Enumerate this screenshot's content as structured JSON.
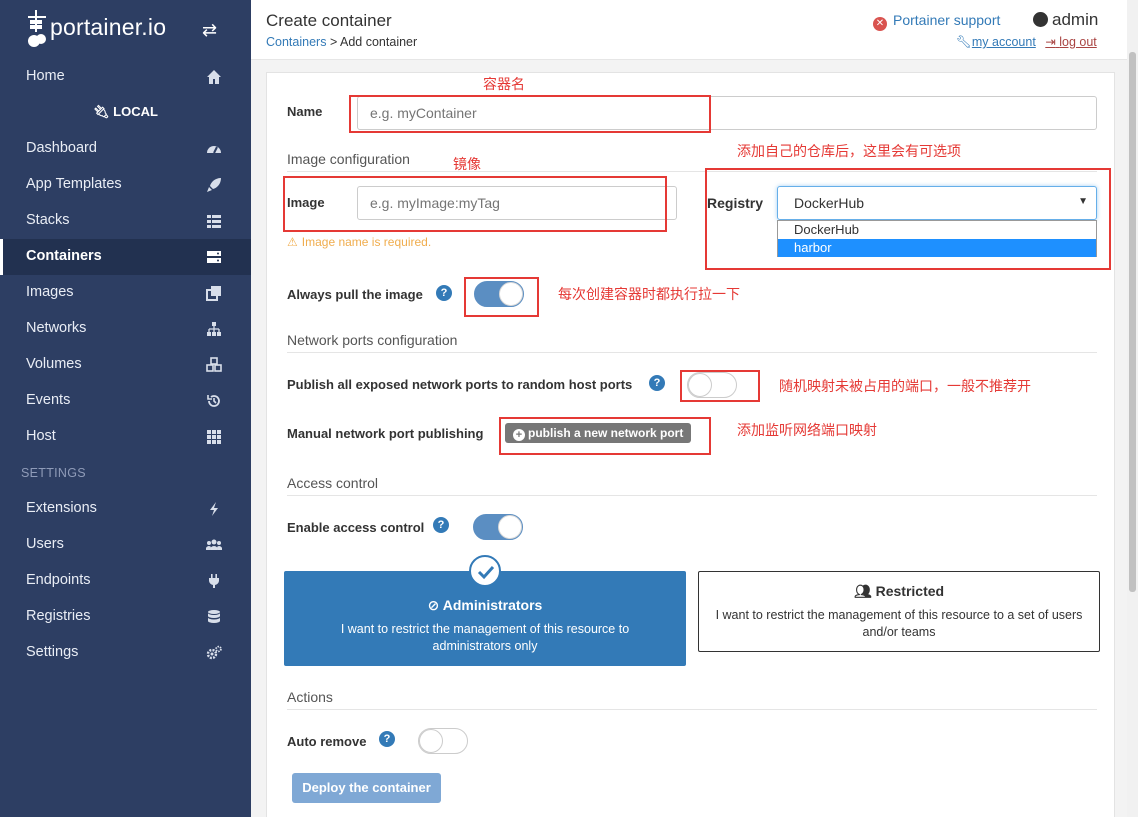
{
  "app": {
    "name": "portainer.io"
  },
  "sidebar": {
    "items": [
      {
        "label": "Home",
        "icon": "home-icon"
      },
      {
        "label": "Dashboard",
        "icon": "tachometer-icon"
      },
      {
        "label": "App Templates",
        "icon": "rocket-icon"
      },
      {
        "label": "Stacks",
        "icon": "th-list-icon"
      },
      {
        "label": "Containers",
        "icon": "server-icon",
        "active": true
      },
      {
        "label": "Images",
        "icon": "clone-icon"
      },
      {
        "label": "Networks",
        "icon": "sitemap-icon"
      },
      {
        "label": "Volumes",
        "icon": "cubes-icon"
      },
      {
        "label": "Events",
        "icon": "history-icon"
      },
      {
        "label": "Host",
        "icon": "th-icon"
      }
    ],
    "endpoint_label": "LOCAL",
    "settings_heading": "SETTINGS",
    "settings_items": [
      {
        "label": "Extensions",
        "icon": "bolt-icon"
      },
      {
        "label": "Users",
        "icon": "users-icon"
      },
      {
        "label": "Endpoints",
        "icon": "plug-icon"
      },
      {
        "label": "Registries",
        "icon": "database-icon"
      },
      {
        "label": "Settings",
        "icon": "cogs-icon"
      }
    ]
  },
  "header": {
    "title": "Create container",
    "breadcrumb_link": "Containers",
    "breadcrumb_current": "> Add container",
    "support_label": "Portainer support",
    "user": "admin",
    "my_account": "my account",
    "log_out": "log out"
  },
  "form": {
    "name_label": "Name",
    "name_placeholder": "e.g. myContainer",
    "image_config_heading": "Image configuration",
    "image_label": "Image",
    "image_placeholder": "e.g. myImage:myTag",
    "image_warning": "Image name is required.",
    "registry_label": "Registry",
    "registry_selected": "DockerHub",
    "registry_options": [
      "DockerHub",
      "harbor"
    ],
    "always_pull_label": "Always pull the image",
    "always_pull": true,
    "network_heading": "Network ports configuration",
    "publish_all_label": "Publish all exposed network ports to random host ports",
    "publish_all": false,
    "manual_publish_label": "Manual network port publishing",
    "publish_button": "publish a new network port",
    "access_heading": "Access control",
    "access_label": "Enable access control",
    "access_enabled": true,
    "admin_title": "Administrators",
    "admin_desc": "I want to restrict the management of this resource to administrators only",
    "restricted_title": "Restricted",
    "restricted_desc": "I want to restrict the management of this resource to a set of users and/or teams",
    "actions_heading": "Actions",
    "auto_remove_label": "Auto remove",
    "auto_remove": false,
    "deploy_button": "Deploy the container"
  },
  "annotations": {
    "name": "容器名",
    "image": "镜像",
    "registry": "添加自己的仓库后，这里会有可选项",
    "always_pull": "每次创建容器时都执行拉一下",
    "publish_all": "随机映射未被占用的端口，一般不推荐开",
    "manual": "添加监听网络端口映射"
  },
  "colors": {
    "sidebar": "#2d3e63",
    "primary": "#337ab7",
    "annotation": "#e53935",
    "warning": "#f0ad4e"
  }
}
